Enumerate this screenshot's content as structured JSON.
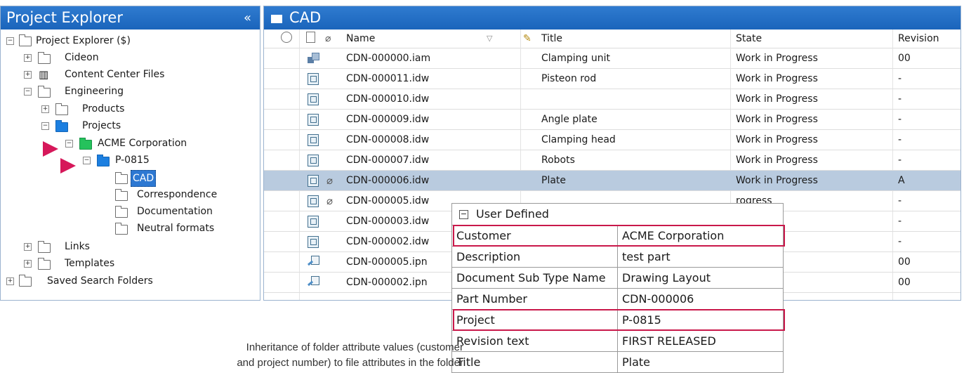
{
  "left_pane": {
    "title": "Project Explorer",
    "collapse_glyph": "«",
    "tree": [
      {
        "label": "Project Explorer ($)",
        "icon": "vault-root-icon"
      },
      {
        "label": "Cideon",
        "icon": "folder-icon"
      },
      {
        "label": "Content Center Files",
        "icon": "library-icon"
      },
      {
        "label": "Engineering",
        "icon": "folder-icon"
      },
      {
        "label": "Products",
        "icon": "folder-icon"
      },
      {
        "label": "Projects",
        "icon": "folder-blue-icon"
      },
      {
        "label": "ACME Corporation",
        "icon": "folder-green-icon"
      },
      {
        "label": "P-0815",
        "icon": "folder-blue-icon"
      },
      {
        "label": "CAD",
        "icon": "folder-icon"
      },
      {
        "label": "Correspondence",
        "icon": "folder-icon"
      },
      {
        "label": "Documentation",
        "icon": "folder-icon"
      },
      {
        "label": "Neutral formats",
        "icon": "folder-icon"
      },
      {
        "label": "Links",
        "icon": "folder-icon"
      },
      {
        "label": "Templates",
        "icon": "folder-icon"
      },
      {
        "label": "Saved Search Folders",
        "icon": "saved-search-icon"
      }
    ]
  },
  "right_pane": {
    "title": "CAD",
    "columns": {
      "name": "Name",
      "title": "Title",
      "state": "State",
      "revision": "Revision"
    },
    "rows": [
      {
        "name": "CDN-000000.iam",
        "title": "Clamping unit",
        "state": "Work in Progress",
        "revision": "00",
        "type": "assembly",
        "attachment": false
      },
      {
        "name": "CDN-000011.idw",
        "title": "Pisteon rod",
        "state": "Work in Progress",
        "revision": "-",
        "type": "drawing",
        "attachment": false
      },
      {
        "name": "CDN-000010.idw",
        "title": "",
        "state": "Work in Progress",
        "revision": "-",
        "type": "drawing",
        "attachment": false
      },
      {
        "name": "CDN-000009.idw",
        "title": "Angle plate",
        "state": "Work in Progress",
        "revision": "-",
        "type": "drawing",
        "attachment": false
      },
      {
        "name": "CDN-000008.idw",
        "title": "Clamping head",
        "state": "Work in Progress",
        "revision": "-",
        "type": "drawing",
        "attachment": false
      },
      {
        "name": "CDN-000007.idw",
        "title": "Robots",
        "state": "Work in Progress",
        "revision": "-",
        "type": "drawing",
        "attachment": false
      },
      {
        "name": "CDN-000006.idw",
        "title": "Plate",
        "state": "Work in Progress",
        "revision": "A",
        "type": "drawing",
        "attachment": true,
        "selected": true
      },
      {
        "name": "CDN-000005.idw",
        "title": "",
        "state": "rogress",
        "revision": "-",
        "type": "drawing",
        "attachment": true
      },
      {
        "name": "CDN-000003.idw",
        "title": "",
        "state": "ogress",
        "revision": "-",
        "type": "drawing",
        "attachment": false
      },
      {
        "name": "CDN-000002.idw",
        "title": "",
        "state": "rogress",
        "revision": "-",
        "type": "drawing",
        "attachment": false
      },
      {
        "name": "CDN-000005.ipn",
        "title": "",
        "state": "rogress",
        "revision": "00",
        "type": "presentation",
        "attachment": false
      },
      {
        "name": "CDN-000002.ipn",
        "title": "",
        "state": "ogress",
        "revision": "00",
        "type": "presentation",
        "attachment": false
      }
    ]
  },
  "popup": {
    "header": "User Defined",
    "props": [
      {
        "key": "Customer",
        "value": "ACME Corporation",
        "highlight": true
      },
      {
        "key": "Description",
        "value": "test part",
        "highlight": false
      },
      {
        "key": "Document Sub Type Name",
        "value": "Drawing Layout",
        "highlight": false
      },
      {
        "key": "Part Number",
        "value": "CDN-000006",
        "highlight": false
      },
      {
        "key": "Project",
        "value": "P-0815",
        "highlight": true
      },
      {
        "key": "Revision text",
        "value": "FIRST RELEASED",
        "highlight": false
      },
      {
        "key": "Title",
        "value": "Plate",
        "highlight": false
      }
    ]
  },
  "caption": {
    "line1": "Inheritance of folder attribute values (customer",
    "line2": "and project number) to file attributes in the folder"
  },
  "colors": {
    "header_blue": "#1f6cc4",
    "highlight_red": "#c9184a",
    "arrow_red": "#d6185a",
    "selected_row": "#b9cbdf"
  }
}
